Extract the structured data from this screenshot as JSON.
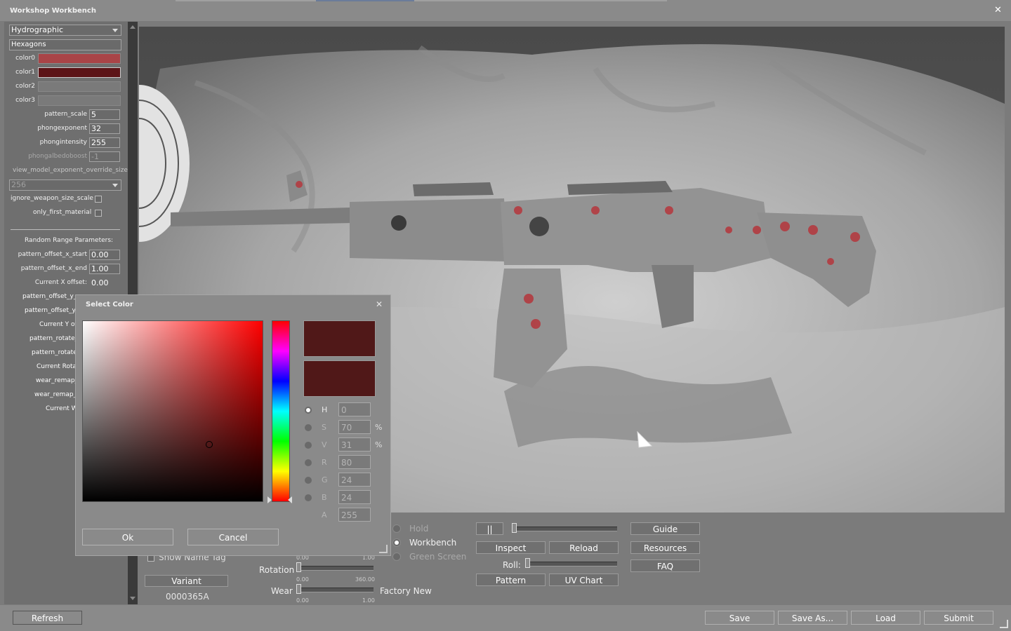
{
  "window": {
    "title": "Workshop Workbench",
    "close": "✕"
  },
  "sidebar": {
    "material_type": "Hydrographic",
    "pattern": "Hexagons",
    "colors": [
      {
        "label": "color0",
        "hex": "#a94447"
      },
      {
        "label": "color1",
        "hex": "#5c1417"
      },
      {
        "label": "color2",
        "hex": "#7a7a7a"
      },
      {
        "label": "color3",
        "hex": "#7a7a7a"
      }
    ],
    "pattern_scale": {
      "label": "pattern_scale",
      "value": "5"
    },
    "phongexponent": {
      "label": "phongexponent",
      "value": "32"
    },
    "phongintensity": {
      "label": "phongintensity",
      "value": "255"
    },
    "phongalbedoboost": {
      "label": "phongalbedoboost",
      "value": "-1"
    },
    "view_model_label": "view_model_exponent_override_size",
    "view_model_value": "256",
    "ignore_weapon_size_scale": "ignore_weapon_size_scale",
    "only_first_material": "only_first_material",
    "random_range_header": "Random Range Parameters:",
    "pattern_offset_x_start": {
      "label": "pattern_offset_x_start",
      "value": "0.00"
    },
    "pattern_offset_x_end": {
      "label": "pattern_offset_x_end",
      "value": "1.00"
    },
    "current_x_offset": {
      "label": "Current X offset:",
      "value": "0.00"
    },
    "rows_partial": [
      "pattern_offset_y_s",
      "pattern_offset_y_",
      "Current Y of",
      "pattern_rotate_s",
      "pattern_rotate_",
      "Current Rota",
      "wear_remap_",
      "wear_remap_",
      "Current W"
    ]
  },
  "dialog": {
    "title": "Select Color",
    "close": "✕",
    "current_color": "#501818",
    "previous_color": "#501818",
    "fields": [
      {
        "label": "H",
        "value": "0",
        "unit": "",
        "selected": true
      },
      {
        "label": "S",
        "value": "70",
        "unit": "%",
        "selected": false
      },
      {
        "label": "V",
        "value": "31",
        "unit": "%",
        "selected": false
      },
      {
        "label": "R",
        "value": "80",
        "unit": "",
        "selected": false
      },
      {
        "label": "G",
        "value": "24",
        "unit": "",
        "selected": false
      },
      {
        "label": "B",
        "value": "24",
        "unit": "",
        "selected": false
      },
      {
        "label": "A",
        "value": "255",
        "unit": "",
        "selected": false
      }
    ],
    "ok": "Ok",
    "cancel": "Cancel"
  },
  "controls": {
    "show_name_tag": "Show Name Tag",
    "variant_button": "Variant",
    "variant_id": "0000365A",
    "rotation_label": "Rotation",
    "rotation_min": "0.00",
    "rotation_max": "360.00",
    "top_slider_min": "0.00",
    "top_slider_max": "1.00",
    "wear_label": "Wear",
    "wear_min": "0.00",
    "wear_max": "1.00",
    "wear_name": "Factory New",
    "mode_hold": "Hold",
    "mode_workbench": "Workbench",
    "mode_green_screen": "Green Screen",
    "pause": "||",
    "inspect": "Inspect",
    "reload": "Reload",
    "roll_label": "Roll:",
    "pattern": "Pattern",
    "uv_chart": "UV Chart",
    "guide": "Guide",
    "resources": "Resources",
    "faq": "FAQ"
  },
  "bottom": {
    "refresh": "Refresh",
    "save": "Save",
    "save_as": "Save As...",
    "load": "Load",
    "submit": "Submit"
  }
}
